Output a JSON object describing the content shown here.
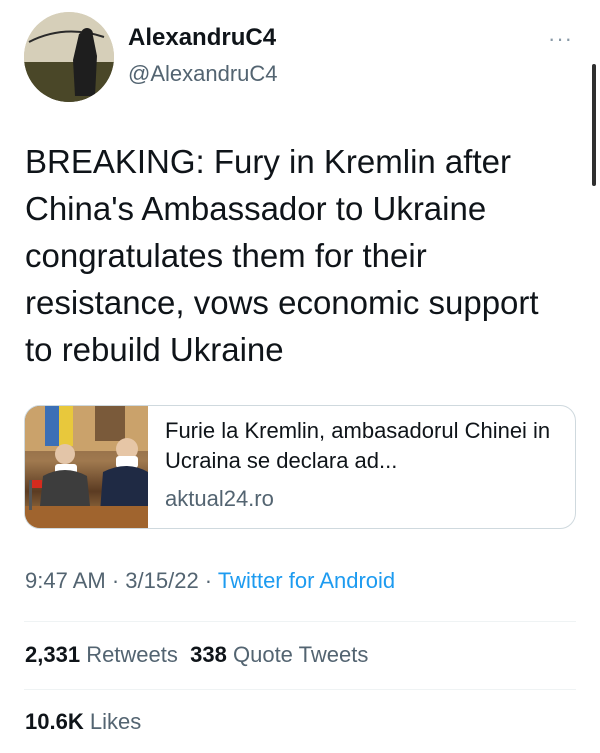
{
  "author": {
    "name": "AlexandruC4",
    "handle": "@AlexandruC4",
    "avatar_icon": "hooded-figure-avatar"
  },
  "more_icon": "more-options-icon",
  "more_label": "···",
  "tweet": {
    "text": "BREAKING: Fury in Kremlin after China's Ambassador to Ukraine congratulates them for their resistance, vows economic support to rebuild Ukraine"
  },
  "link_card": {
    "title": "Furie la Kremlin, ambasadorul Chinei in Ucraina se declara ad...",
    "domain": "aktual24.ro",
    "image_icon": "news-photo-thumbnail"
  },
  "meta": {
    "time": "9:47 AM",
    "separator1": " · ",
    "date": "3/15/22",
    "separator2": " · ",
    "source": "Twitter for Android"
  },
  "stats": {
    "retweets_count": "2,331",
    "retweets_label": "Retweets",
    "quotes_count": "338",
    "quotes_label": "Quote Tweets",
    "likes_count": "10.6K",
    "likes_label": "Likes"
  },
  "colors": {
    "link": "#1d9bf0",
    "secondary_text": "#536471",
    "primary_text": "#0f1419",
    "border": "#cfd9de"
  }
}
